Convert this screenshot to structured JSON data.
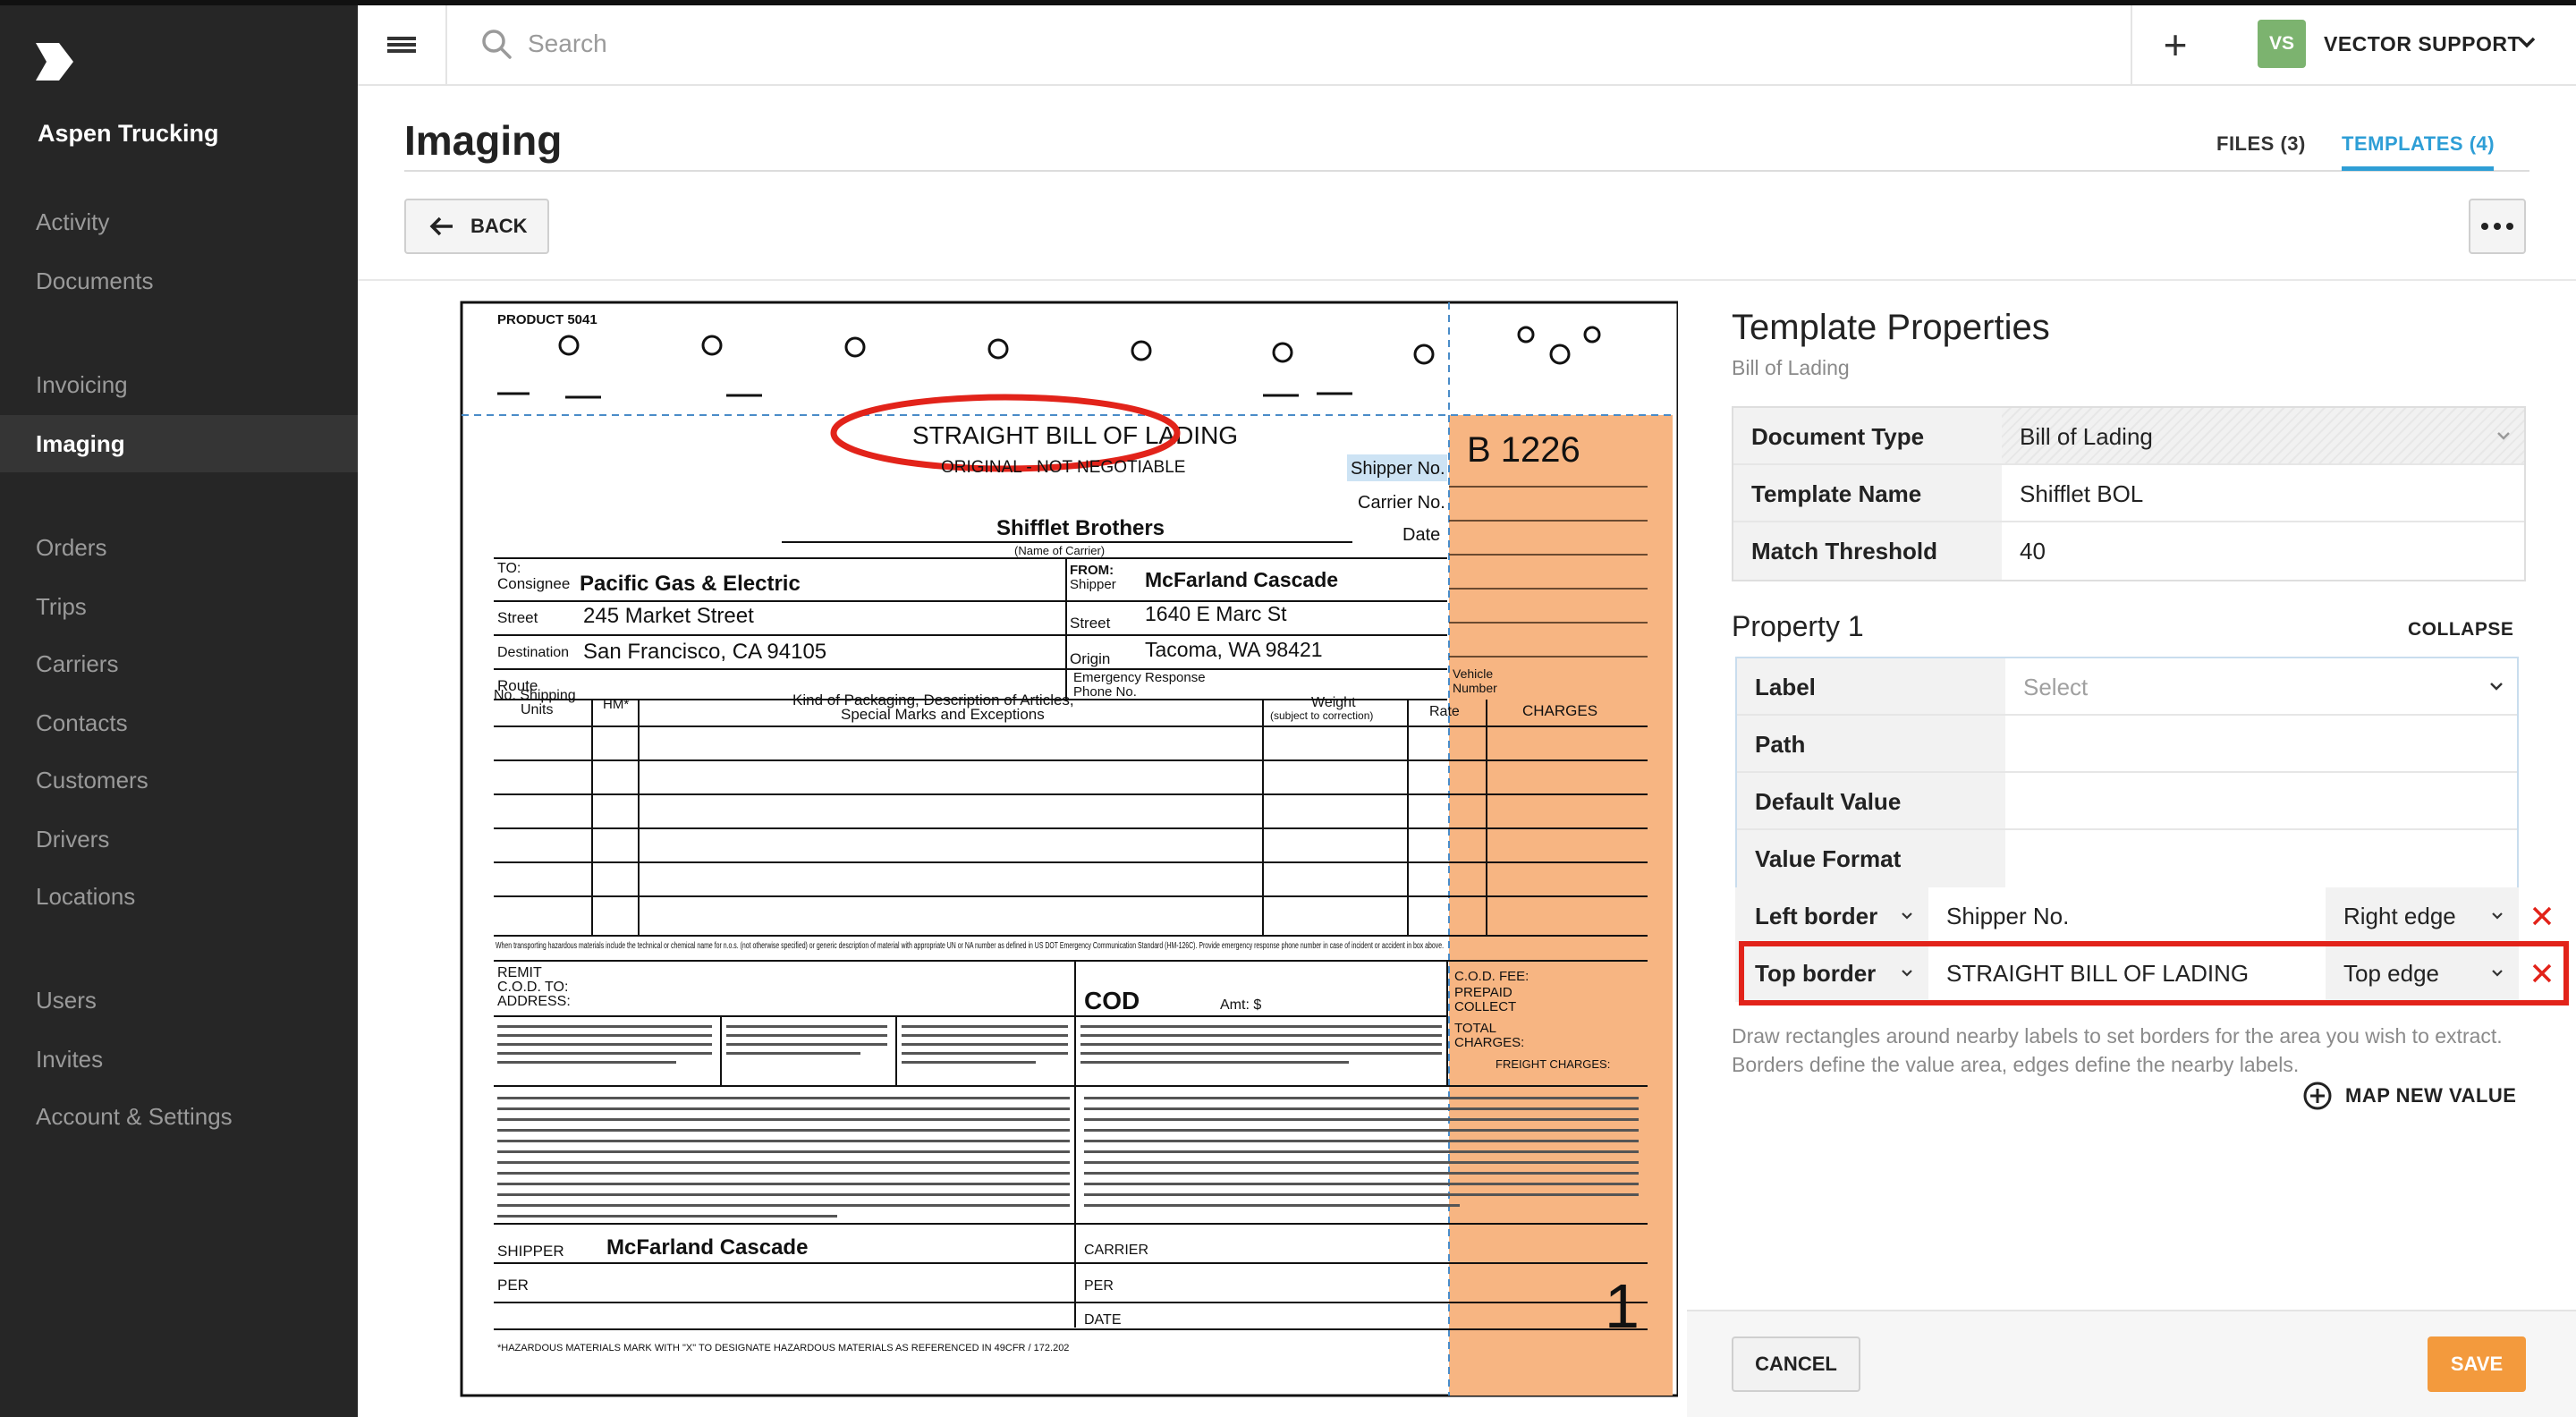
{
  "app": {
    "company": "Aspen Trucking",
    "logo_icon": "aspen-chevron-logo"
  },
  "sidebar": {
    "items": [
      {
        "label": "Activity",
        "active": false
      },
      {
        "label": "Documents",
        "active": false
      },
      {
        "label": "Invoicing",
        "active": false
      },
      {
        "label": "Imaging",
        "active": true
      },
      {
        "label": "Orders",
        "active": false
      },
      {
        "label": "Trips",
        "active": false
      },
      {
        "label": "Carriers",
        "active": false
      },
      {
        "label": "Contacts",
        "active": false
      },
      {
        "label": "Customers",
        "active": false
      },
      {
        "label": "Drivers",
        "active": false
      },
      {
        "label": "Locations",
        "active": false
      },
      {
        "label": "Users",
        "active": false
      },
      {
        "label": "Invites",
        "active": false
      },
      {
        "label": "Account & Settings",
        "active": false
      }
    ]
  },
  "topbar": {
    "search_placeholder": "Search",
    "add_icon": "plus-icon",
    "user_initials": "VS",
    "user_name": "VECTOR SUPPORT",
    "avatar_color": "#7cb36f"
  },
  "page": {
    "title": "Imaging",
    "tabs": [
      {
        "label": "FILES (3)",
        "active": false
      },
      {
        "label": "TEMPLATES (4)",
        "active": true
      }
    ],
    "back_label": "BACK",
    "accent_color": "#2e9ed6"
  },
  "document": {
    "product": "PRODUCT 5041",
    "title": "STRAIGHT BILL OF LADING",
    "subtitle": "ORIGINAL - NOT NEGOTIABLE",
    "shipper_no_label": "Shipper No.",
    "carrier_no_label": "Carrier No.",
    "date_label": "Date",
    "bill_number": "B   1226",
    "carrier_name": "Shifflet Brothers",
    "carrier_caption": "(Name of Carrier)",
    "to_label": "TO:",
    "consignee_label": "Consignee",
    "consignee": "Pacific Gas & Electric",
    "street_label": "Street",
    "consignee_street": "245 Market Street",
    "destination_label": "Destination",
    "destination": "San Francisco, CA 94105",
    "route_label": "Route",
    "from_label": "FROM:",
    "shipper_label": "Shipper",
    "shipper": "McFarland Cascade",
    "shipper_street": "1640 E Marc St",
    "origin_label": "Origin",
    "origin": "Tacoma, WA 98421",
    "emergency_label": "Emergency Response",
    "phone_label": "Phone No.",
    "vehicle_label": "Vehicle",
    "vehicle_number_label": "Number",
    "col_units": "No. Shipping",
    "col_units2": "Units",
    "col_hm": "HM*",
    "col_desc": "Kind of Packaging, Description of Articles,",
    "col_desc2": "Special Marks and Exceptions",
    "col_weight": "Weight",
    "col_weight2": "(subject to correction)",
    "col_rate": "Rate",
    "col_charges": "CHARGES",
    "remit_label": "REMIT",
    "cod_to_label": "C.O.D. TO:",
    "address_label": "ADDRESS:",
    "cod_label": "COD",
    "amt_label": "Amt:  $",
    "cod_fee_label": "C.O.D. FEE:",
    "prepaid_label": "PREPAID",
    "collect_label": "COLLECT",
    "total_charges_label": "TOTAL",
    "total_charges_label2": "CHARGES:",
    "freight_charges_label": "FREIGHT CHARGES:",
    "shipper_sign_label": "SHIPPER",
    "shipper_sign": "McFarland Cascade",
    "per_label": "PER",
    "carrier_sign_label": "CARRIER",
    "date_sign_label": "DATE",
    "hazard_note": "*HAZARDOUS MATERIALS     MARK WITH \"X\" TO DESIGNATE HAZARDOUS MATERIALS AS REFERENCED IN 49CFR / 172.202",
    "hazard_text": "When transporting hazardous materials include the technical or chemical name for n.o.s. (not otherwise specified) or generic description of material with appropriate UN or NA number as defined in US DOT Emergency Communication Standard (HM-126C). Provide emergency response phone number in case of incident or accident in box above.",
    "page_number": "1",
    "highlight_color": "#f7b582"
  },
  "template": {
    "title": "Template Properties",
    "subtitle": "Bill of Lading",
    "rows": [
      {
        "key": "Document Type",
        "value": "Bill of Lading"
      },
      {
        "key": "Template Name",
        "value": "Shifflet BOL"
      },
      {
        "key": "Match Threshold",
        "value": "40"
      }
    ]
  },
  "property1": {
    "title": "Property 1",
    "collapse_label": "COLLAPSE",
    "label_key": "Label",
    "label_placeholder": "Select",
    "path_key": "Path",
    "default_value_key": "Default Value",
    "value_format_key": "Value Format",
    "left_border": {
      "key": "Left border",
      "value": "Shipper No.",
      "edge": "Right edge"
    },
    "top_border": {
      "key": "Top border",
      "value": "STRAIGHT BILL OF LADING",
      "edge": "Top edge"
    },
    "hint": "Draw rectangles around nearby labels to set borders for the area you wish to extract. Borders define the value area, edges define the nearby labels.",
    "map_new_value_label": "MAP NEW VALUE",
    "remove_color": "#e2231a"
  },
  "footer": {
    "cancel_label": "CANCEL",
    "save_label": "SAVE",
    "save_color": "#f39a3d"
  }
}
